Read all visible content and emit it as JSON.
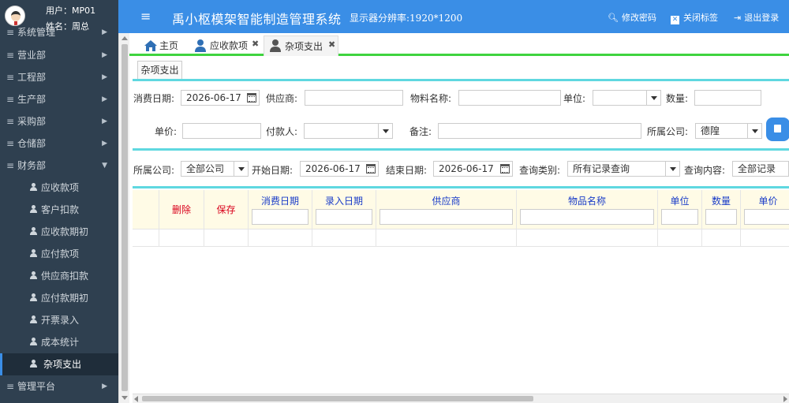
{
  "user": {
    "account_label": "用户：MP01",
    "name_label": "姓名：周总"
  },
  "sidebar": {
    "items": [
      {
        "label": "系统管理"
      },
      {
        "label": "营业部"
      },
      {
        "label": "工程部"
      },
      {
        "label": "生产部"
      },
      {
        "label": "采购部"
      },
      {
        "label": "仓储部"
      },
      {
        "label": "财务部"
      }
    ],
    "finance_subitems": [
      {
        "label": "应收款项"
      },
      {
        "label": "客户扣款"
      },
      {
        "label": "应收款期初"
      },
      {
        "label": "应付款项"
      },
      {
        "label": "供应商扣款"
      },
      {
        "label": "应付款期初"
      },
      {
        "label": "开票录入"
      },
      {
        "label": "成本统计"
      },
      {
        "label": "杂项支出"
      }
    ],
    "last_item": {
      "label": "管理平台"
    }
  },
  "header": {
    "menu_glyph": "≡",
    "title": "禹小枢模架智能制造管理系统",
    "resolution": "显示器分辨率:1920*1200",
    "change_password": "修改密码",
    "close_tabs": "关闭标签",
    "logout": "退出登录"
  },
  "tabs": [
    {
      "label": "主页",
      "icon": "home-icon"
    },
    {
      "label": "应收款项",
      "icon": "user-icon",
      "closable": true
    },
    {
      "label": "杂项支出",
      "icon": "user-icon",
      "closable": true,
      "active": true
    }
  ],
  "tab_close_glyph": "✖",
  "subtab": {
    "label": "杂项支出"
  },
  "entry_form": {
    "expense_date_label": "消费日期:",
    "expense_date_value": "2026-06-17",
    "supplier_label": "供应商:",
    "supplier_value": "",
    "material_label": "物料名称:",
    "material_value": "",
    "unit_label": "单位:",
    "unit_value": "",
    "quantity_label": "数量:",
    "quantity_value": "",
    "price_label": "单价:",
    "price_value": "",
    "payer_label": "付款人:",
    "payer_value": "",
    "remark_label": "备注:",
    "remark_value": "",
    "company_label": "所属公司:",
    "company_value": "德隍"
  },
  "query_form": {
    "company_label": "所属公司:",
    "company_value": "全部公司",
    "start_label": "开始日期:",
    "start_value": "2026-06-17",
    "end_label": "结束日期:",
    "end_value": "2026-06-17",
    "type_label": "查询类别:",
    "type_value": "所有记录查询",
    "content_label": "查询内容:",
    "content_value": "全部记录"
  },
  "table": {
    "delete_label": "删除",
    "save_label": "保存",
    "columns": [
      "消费日期",
      "录入日期",
      "供应商",
      "物品名称",
      "单位",
      "数量",
      "单价"
    ]
  },
  "colors": {
    "header_blue": "#3a8ee6",
    "sidebar_dark": "#2f4050",
    "column_header_blue": "#1a3cc8",
    "action_red": "#d9001b",
    "tab_green": "#3fd43f",
    "divider_cyan": "#5fd8e0"
  }
}
